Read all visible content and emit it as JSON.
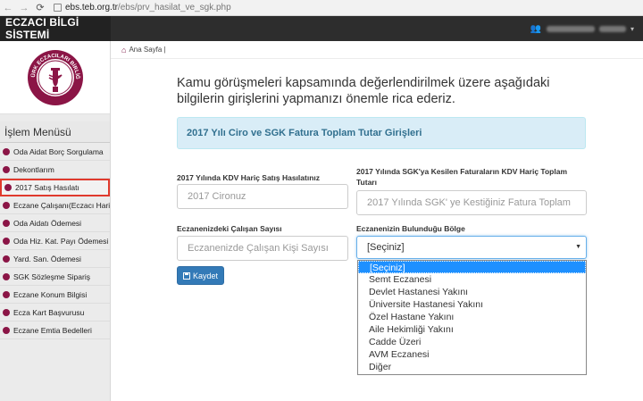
{
  "browser": {
    "back": "←",
    "forward": "→",
    "reload": "⟳",
    "url_host": "ebs.teb.org.tr",
    "url_path": "/ebs/prv_hasilat_ve_sgk.php"
  },
  "header": {
    "brand": "ECZACI BİLGİ SİSTEMİ",
    "user_icon": "users-icon",
    "caret": "▾"
  },
  "sidebar": {
    "logo_text": "TÜRK ECZACILARI BİRLİĞİ",
    "menu_title": "İşlem Menüsü",
    "items": [
      {
        "label": "Oda Aidat Borç Sorgulama"
      },
      {
        "label": "Dekontlarım"
      },
      {
        "label": "2017 Satış Hasılatı"
      },
      {
        "label": "Eczane Çalışanı(Eczacı Hariç)"
      },
      {
        "label": "Oda Aidatı Ödemesi"
      },
      {
        "label": "Oda Hiz. Kat. Payı Ödemesi"
      },
      {
        "label": "Yard. San. Ödemesi"
      },
      {
        "label": "SGK Sözleşme Sipariş"
      },
      {
        "label": "Eczane Konum Bilgisi"
      },
      {
        "label": "Ecza Kart Başvurusu"
      },
      {
        "label": "Eczane Emtia Bedelleri"
      }
    ]
  },
  "breadcrumb": {
    "home_label": "Ana Sayfa |"
  },
  "main": {
    "intro": "Kamu görüşmeleri kapsamında değerlendirilmek üzere aşağıdaki bilgilerin girişlerini yapmanızı önemle rica ederiz.",
    "alert_title": "2017 Yılı Ciro ve SGK Fatura Toplam Tutar Girişleri",
    "fields": {
      "kdv_label": "2017 Yılında KDV Hariç Satış Hasılatınız",
      "kdv_placeholder": "2017 Cironuz",
      "sgk_label": "2017 Yılında SGK'ya Kesilen Faturaların KDV Hariç Toplam Tutarı",
      "sgk_placeholder": "2017 Yılında SGK' ye Kestiğiniz Fatura Toplam",
      "calisan_label": "Eczanenizdeki Çalışan Sayısı",
      "calisan_placeholder": "Eczanenizde Çalışan Kişi Sayısı",
      "bolge_label": "Eczanenizin Bulunduğu Bölge",
      "bolge_value": "[Seçiniz]"
    },
    "bolge_options": [
      "[Seçiniz]",
      "Semt Eczanesi",
      "Devlet Hastanesi Yakını",
      "Üniversite Hastanesi Yakını",
      "Özel Hastane Yakını",
      "Aile Hekimliği Yakını",
      "Cadde Üzeri",
      "AVM Eczanesi",
      "Diğer"
    ],
    "save_label": "Kaydet"
  },
  "colors": {
    "accent": "#337ab7",
    "brand_dot": "#8b1546",
    "alert_bg": "#d9edf7",
    "highlight": "#e03a2d"
  }
}
